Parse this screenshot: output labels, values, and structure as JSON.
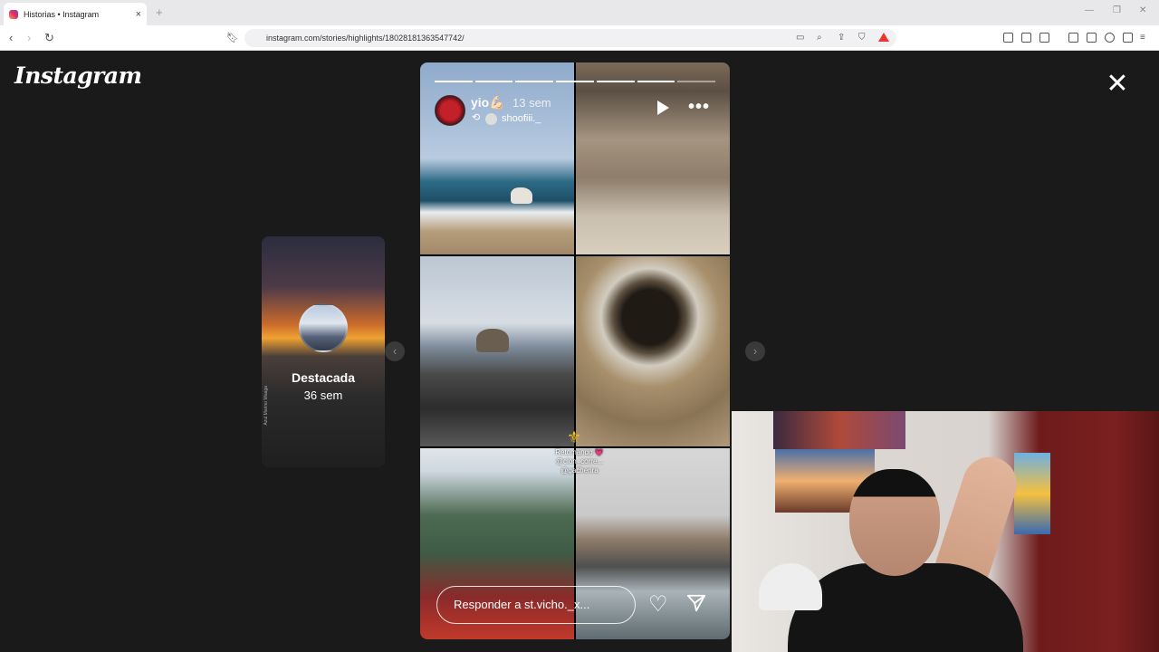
{
  "browser": {
    "tab_title": "Historias • Instagram",
    "tab_close": "×",
    "new_tab": "+",
    "url": "instagram.com/stories/highlights/18028181363547742/"
  },
  "page": {
    "logo": "Instagram",
    "close": "✕"
  },
  "prev_highlight": {
    "title": "Destacada",
    "time": "36 sem",
    "side_text": "Azul Marino Waaga"
  },
  "story": {
    "username": "yio💪🏻",
    "time": "13 sem",
    "reposted_from": "shoofiii._",
    "more": "•••",
    "segments_total": 7,
    "segments_done": 6,
    "overlay_text": [
      "Retomando 💗",
      "@clon_corre...",
      "@gacherira"
    ],
    "reply_placeholder": "Responder a st.vicho._x..."
  },
  "nav": {
    "prev": "‹",
    "next": "›"
  },
  "icons": [
    "close-icon",
    "play-icon",
    "more-icon",
    "heart-icon",
    "send-icon",
    "repost-icon",
    "chevron-left-icon",
    "chevron-right-icon"
  ]
}
